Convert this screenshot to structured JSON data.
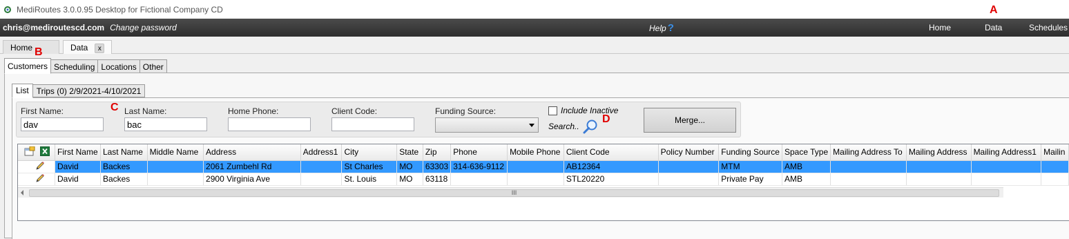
{
  "window": {
    "title": "MediRoutes 3.0.0.95 Desktop for Fictional Company CD"
  },
  "topbar": {
    "user": "chris@mediroutescd.com",
    "change_password": "Change password",
    "help": "Help",
    "help_icon": "?",
    "nav": [
      "Home",
      "Data",
      "Schedules"
    ]
  },
  "markers": {
    "a": "A",
    "b": "B",
    "c": "C",
    "d": "D"
  },
  "doc_tabs": {
    "home": "Home",
    "data": "Data",
    "close": "x"
  },
  "tabs": [
    "Customers",
    "Scheduling",
    "Locations",
    "Other"
  ],
  "subtabs": [
    "List",
    "Trips (0) 2/9/2021-4/10/2021"
  ],
  "search": {
    "first_name_label": "First Name:",
    "first_name_value": "dav",
    "last_name_label": "Last Name:",
    "last_name_value": "bac",
    "home_phone_label": "Home Phone:",
    "home_phone_value": "",
    "client_code_label": "Client Code:",
    "client_code_value": "",
    "funding_source_label": "Funding Source:",
    "funding_source_value": "",
    "include_inactive": "Include Inactive",
    "search_label": "Search..",
    "merge": "Merge..."
  },
  "grid": {
    "columns": [
      "First Name",
      "Last Name",
      "Middle Name",
      "Address",
      "Address1",
      "City",
      "State",
      "Zip",
      "Phone",
      "Mobile Phone",
      "Client Code",
      "Policy Number",
      "Funding Source",
      "Space Type",
      "Mailing Address To",
      "Mailing Address",
      "Mailing Address1",
      "Mailin"
    ],
    "rows": [
      [
        "David",
        "Backes",
        "",
        "2061 Zumbehl Rd",
        "",
        "St Charles",
        "MO",
        "63303",
        "314-636-9112",
        "",
        "AB12364",
        "",
        "MTM",
        "AMB",
        "",
        "",
        "",
        ""
      ],
      [
        "David",
        "Backes",
        "",
        "2900 Virginia Ave",
        "",
        "St. Louis",
        "MO",
        "63118",
        "",
        "",
        "STL20220",
        "",
        "Private Pay",
        "AMB",
        "",
        "",
        "",
        ""
      ]
    ],
    "scroll_grip": "III"
  },
  "colors": {
    "selected_row": "#3399ff",
    "topbar": "#3a3a3a",
    "marker": "#e00000"
  }
}
